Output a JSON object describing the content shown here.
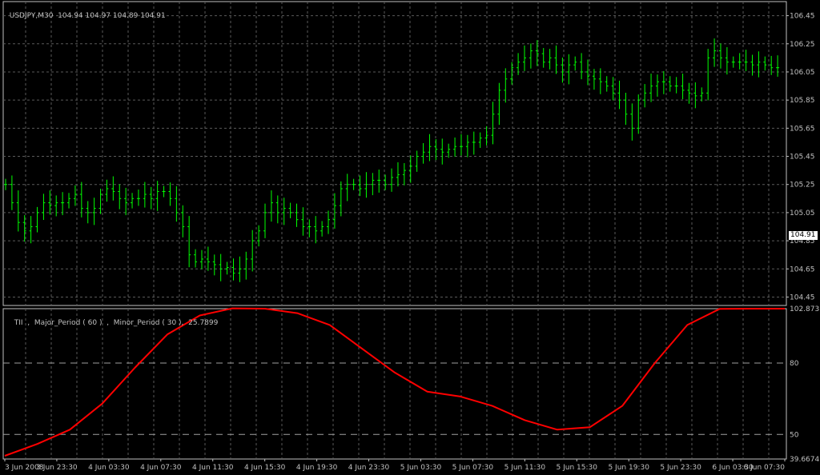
{
  "main_header": {
    "symbol": "USDJPY,M30",
    "ohlc": "104.94 104.97 104.89 104.91"
  },
  "indicator_header": {
    "label": "TII  ,  Major_Period ( 60 )  ,  Minor_Period ( 30 ),  25.7899"
  },
  "current_price_tag": "104.91",
  "colors": {
    "background": "#000000",
    "grid": "#5a5a5a",
    "bars": "#00ff00",
    "indicator": "#ff0000",
    "text": "#c0c0c0"
  },
  "chart_data": [
    {
      "type": "ohlc",
      "name": "USDJPY,M30",
      "ylim": [
        104.39,
        106.55
      ],
      "y_ticks": [
        "106.45",
        "106.25",
        "106.05",
        "105.85",
        "105.65",
        "105.45",
        "105.25",
        "105.05",
        "104.85",
        "104.65",
        "104.45"
      ],
      "x_ticks": [
        "3 Jun 2008",
        "3 Jun 23:30",
        "4 Jun 03:30",
        "4 Jun 07:30",
        "4 Jun 11:30",
        "4 Jun 15:30",
        "4 Jun 19:30",
        "4 Jun 23:30",
        "5 Jun 03:30",
        "5 Jun 07:30",
        "5 Jun 11:30",
        "5 Jun 15:30",
        "5 Jun 19:30",
        "5 Jun 23:30",
        "6 Jun 03:30",
        "6 Jun 07:30"
      ],
      "closes": [
        105.25,
        105.12,
        104.98,
        104.92,
        104.95,
        105.05,
        105.12,
        105.1,
        105.12,
        105.12,
        105.15,
        105.18,
        105.08,
        105.05,
        105.08,
        105.18,
        105.22,
        105.2,
        105.15,
        105.12,
        105.15,
        105.15,
        105.18,
        105.15,
        105.2,
        105.2,
        105.15,
        105.05,
        104.95,
        104.75,
        104.7,
        104.72,
        104.7,
        104.68,
        104.65,
        104.66,
        104.62,
        104.65,
        104.72,
        104.85,
        104.92,
        105.05,
        105.12,
        105.05,
        105.08,
        105.05,
        105.0,
        104.95,
        104.95,
        104.92,
        104.95,
        105.0,
        105.1,
        105.22,
        105.25,
        105.25,
        105.22,
        105.25,
        105.28,
        105.28,
        105.25,
        105.3,
        105.32,
        105.35,
        105.38,
        105.45,
        105.48,
        105.52,
        105.5,
        105.48,
        105.5,
        105.52,
        105.52,
        105.55,
        105.55,
        105.58,
        105.6,
        105.75,
        105.92,
        106.0,
        106.08,
        106.12,
        106.15,
        106.2,
        106.18,
        106.12,
        106.15,
        106.1,
        106.05,
        106.1,
        106.12,
        106.05,
        106.02,
        106.0,
        105.98,
        105.95,
        105.9,
        105.85,
        105.75,
        105.65,
        105.85,
        105.9,
        105.95,
        105.98,
        105.98,
        105.95,
        105.95,
        105.92,
        105.9,
        105.88,
        105.9,
        106.15,
        106.2,
        106.15,
        106.12,
        106.12,
        106.12,
        106.12,
        106.1,
        106.12,
        106.1,
        106.08,
        106.08
      ],
      "y_ranges": [
        [
          104.95,
          105.32
        ],
        [
          104.95,
          105.15
        ]
      ]
    },
    {
      "type": "line",
      "name": "TII",
      "ylim": [
        39.6674,
        102.873
      ],
      "y_ticks": [
        "102.873",
        "80",
        "50",
        "39.6674"
      ],
      "levels": [
        80,
        50
      ],
      "x": [
        0,
        5,
        10,
        15,
        20,
        25,
        30,
        35,
        40,
        45,
        50,
        55,
        60,
        65,
        70,
        75,
        80,
        85,
        90,
        95,
        100,
        105,
        110,
        115,
        120
      ],
      "values": [
        41,
        46,
        52,
        63,
        78,
        92,
        100,
        103,
        102.873,
        101,
        96,
        86,
        76,
        68,
        66,
        62,
        56,
        52,
        53,
        62,
        80,
        96,
        102.8,
        102.873,
        102.873
      ]
    }
  ]
}
